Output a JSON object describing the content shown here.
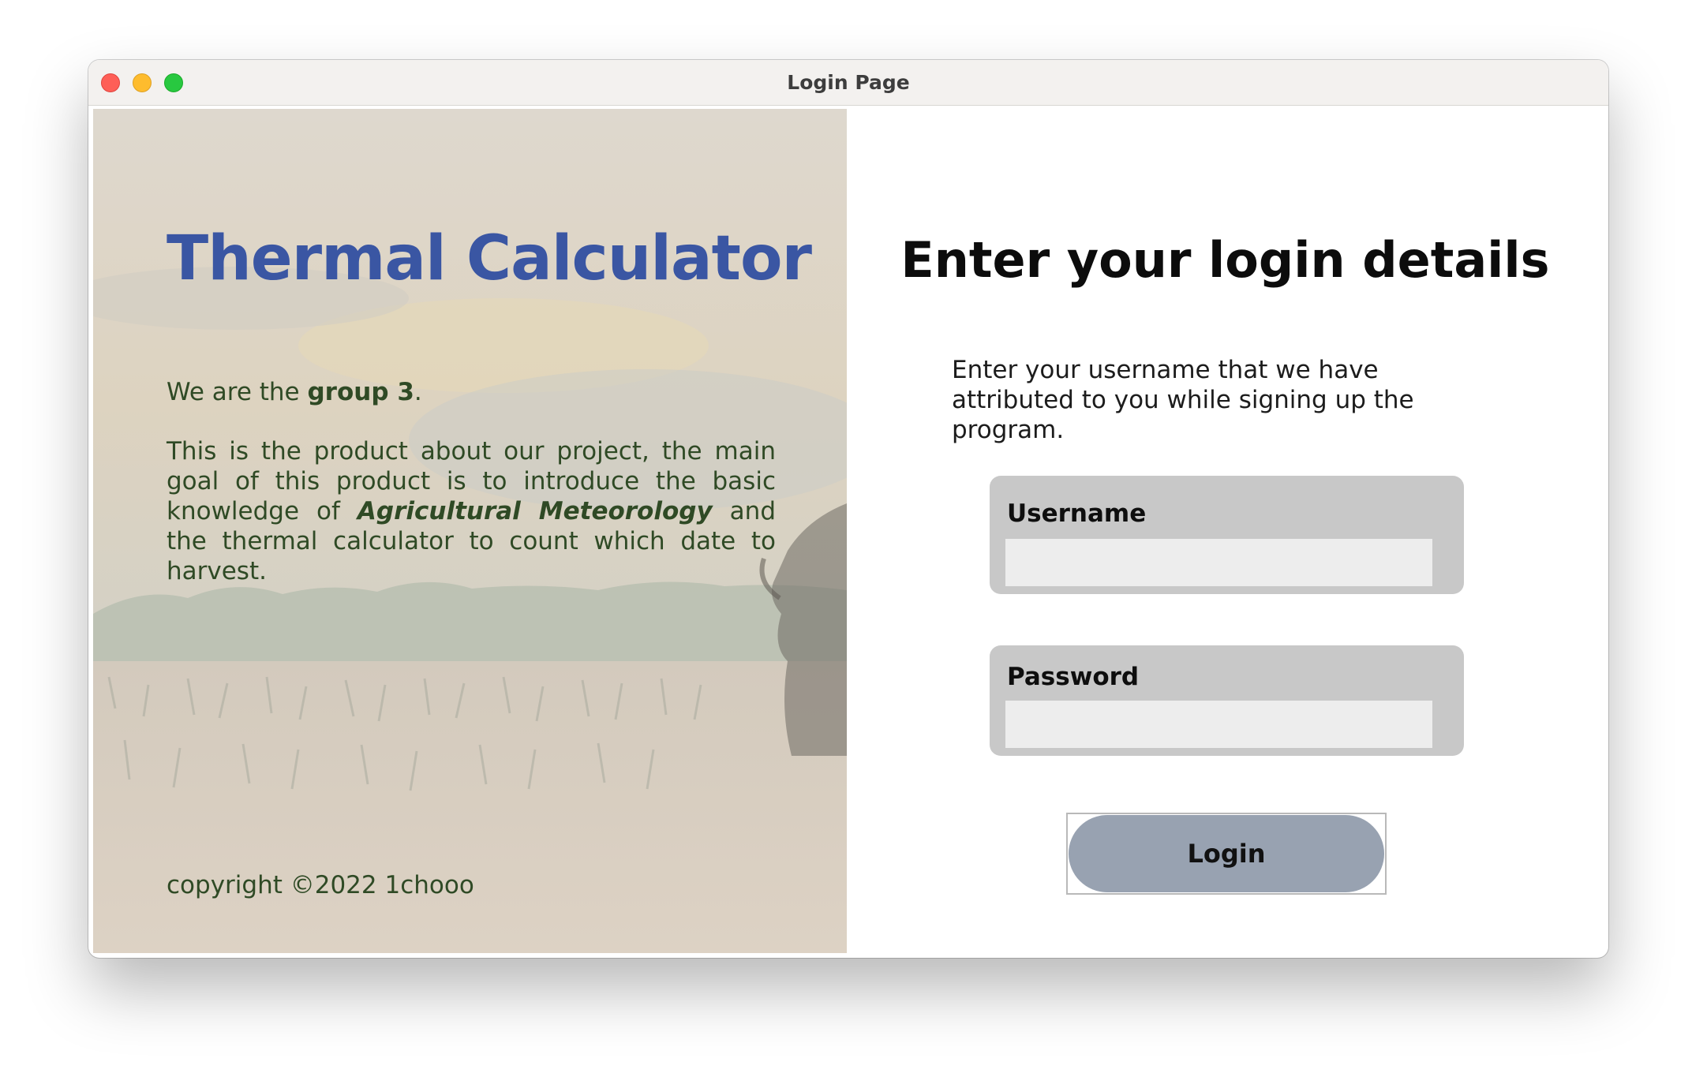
{
  "window": {
    "title": "Login Page"
  },
  "left_panel": {
    "title": "Thermal Calculator",
    "intro": {
      "prefix": "We are the ",
      "bold": "group 3",
      "suffix": "."
    },
    "description": {
      "before": "This is the product about our project, the main goal of this product is to introduce the basic knowledge of ",
      "emphasis": "Agricultural Meteorology",
      "after": " and the thermal calculator to count which date to harvest."
    },
    "copyright": "copyright ©2022 1chooo"
  },
  "right_panel": {
    "heading": "Enter your login details",
    "hint": "Enter your username that we have attributed to you while signing up the program.",
    "username": {
      "label": "Username",
      "value": "",
      "placeholder": ""
    },
    "password": {
      "label": "Password",
      "value": "",
      "placeholder": ""
    },
    "login_button": "Login"
  },
  "colors": {
    "title_blue": "#3a56a3",
    "text_green": "#2f4a25",
    "field_bg": "#c8c8c8",
    "input_bg": "#ededed",
    "button_bg": "#98a2b1"
  }
}
